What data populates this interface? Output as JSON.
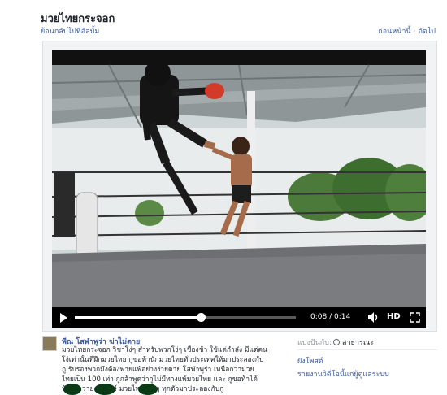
{
  "page": {
    "title": "มวยไทยกระจอก",
    "back_label": "ย้อนกลับไปที่อัลบั้ม",
    "prev_label": "ก่อนหน้านี้",
    "next_label": "ถัดไป"
  },
  "video": {
    "current_time": "0:08",
    "time_sep": "/",
    "duration": "0:14",
    "progress": 0.57,
    "hd_label": "HD",
    "play_icon": "play-icon",
    "volume_icon": "volume-icon",
    "fullscreen_icon": "fullscreen-icon"
  },
  "post": {
    "author": "พีณ โสฬาพูร่า ฆ่าไม่ตาย",
    "lines": [
      "มวยไทยกระจอก วิชาโง่ๆ สำหรับพวกโง่ๆ เชื่องช้า ใช้แต่กำลัง มีแต่คน",
      "โง่เท่านั้นที่ฝึกมวยไทย กูขอท้านักมวยไทยทั่วประเทศให้มาประลองกับ",
      "กู รับรองพวกมึงต้องพ่ายแพ้อย่างง่ายดาย โสฬาพูร่า เหนือกว่ามวย",
      "ไทยเป็น 100 เท่า กูกล้าพูดว่ากูไม่มีทางแพ้มวยไทย และ กูขอท้าได้",
      "บ้างขาวาย ยมรักษ์ มวยไทยสวยๆ ทุกตัวมาประลองกับกู"
    ]
  },
  "sidebar": {
    "shared_with_label": "แบ่งปันกับ:",
    "privacy_label": "สาธารณะ",
    "post_label": "ฝังโพสต์",
    "report_label": "รายงานวิดีโอนี้แก่ผู้ดูแลระบบ"
  }
}
